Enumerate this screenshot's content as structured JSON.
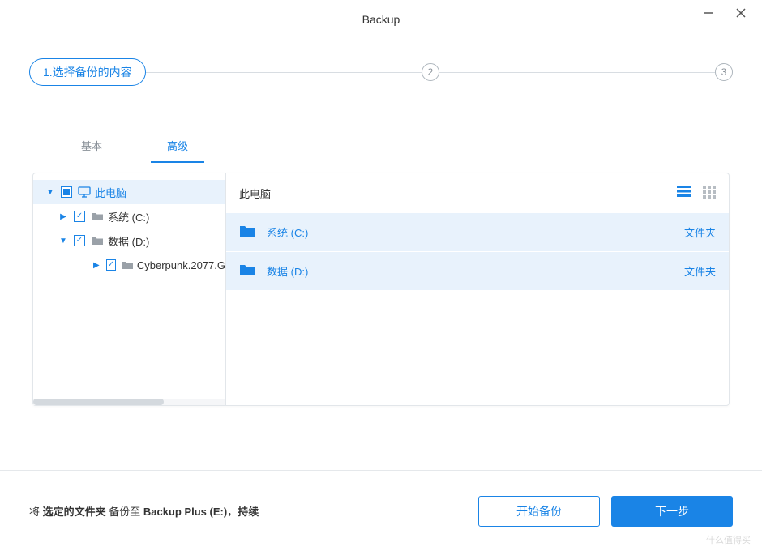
{
  "title": "Backup",
  "stepper": {
    "active_label": "1.选择备份的内容",
    "step2": "2",
    "step3": "3"
  },
  "tabs": {
    "basic": "基本",
    "advanced": "高级"
  },
  "tree": {
    "computer": "此电脑",
    "driveC": "系统 (C:)",
    "driveD": "数据 (D:)",
    "sub": "Cyberpunk.2077.G"
  },
  "details": {
    "header": "此电脑",
    "rows": [
      {
        "name": "系统 (C:)",
        "kind": "文件夹"
      },
      {
        "name": "数据 (D:)",
        "kind": "文件夹"
      }
    ]
  },
  "footer": {
    "prefix": "将 ",
    "b1": "选定的文件夹",
    "mid1": " 备份至 ",
    "b2": "Backup Plus (E:)",
    "mid2": "，",
    "b3": "持续"
  },
  "buttons": {
    "start": "开始备份",
    "next": "下一步"
  },
  "watermark": "什么值得买"
}
